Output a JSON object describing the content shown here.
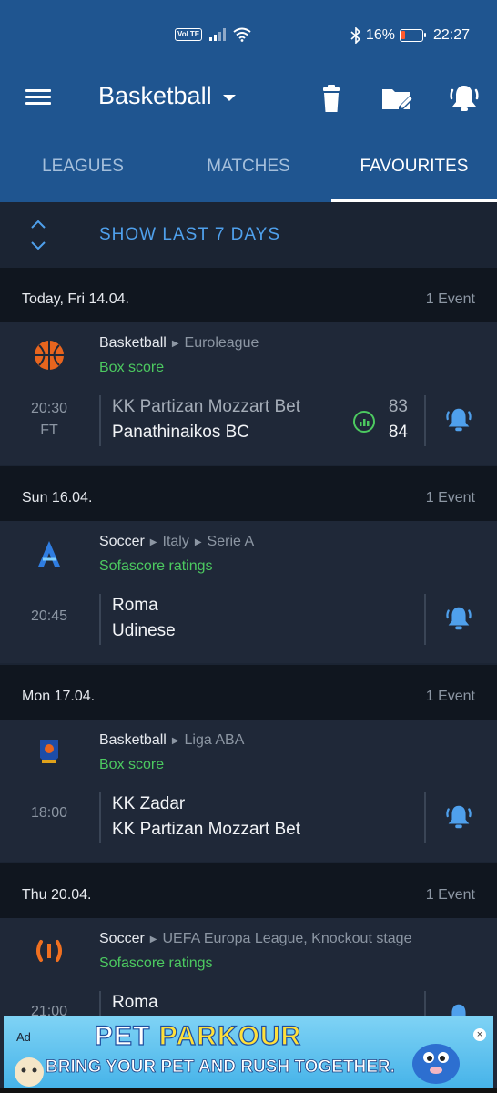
{
  "status_bar": {
    "volte": "VoLTE",
    "battery": "16%",
    "time": "22:27"
  },
  "toolbar": {
    "title": "Basketball",
    "icons": [
      "menu-icon",
      "delete-icon",
      "edit-folder-icon",
      "bell-icon"
    ]
  },
  "tabs": [
    {
      "label": "LEAGUES",
      "active": false
    },
    {
      "label": "MATCHES",
      "active": false
    },
    {
      "label": "FAVOURITES",
      "active": true
    }
  ],
  "show_last": "SHOW LAST 7 DAYS",
  "groups": [
    {
      "date": "Today, Fri 14.04.",
      "count": "1 Event",
      "event": {
        "sport": "Basketball",
        "path": [
          "Euroleague"
        ],
        "link": "Box score",
        "time": "20:30",
        "status": "FT",
        "home": "KK Partizan Mozzart Bet",
        "away": "Panathinaikos BC",
        "home_score": "83",
        "away_score": "84"
      }
    },
    {
      "date": "Sun 16.04.",
      "count": "1 Event",
      "event": {
        "sport": "Soccer",
        "path": [
          "Italy",
          "Serie A"
        ],
        "link": "Sofascore ratings",
        "time": "20:45",
        "home": "Roma",
        "away": "Udinese"
      }
    },
    {
      "date": "Mon 17.04.",
      "count": "1 Event",
      "event": {
        "sport": "Basketball",
        "path": [
          "Liga ABA"
        ],
        "link": "Box score",
        "time": "18:00",
        "home": "KK Zadar",
        "away": "KK Partizan Mozzart Bet"
      }
    },
    {
      "date": "Thu 20.04.",
      "count": "1 Event",
      "event": {
        "sport": "Soccer",
        "path": [
          "UEFA Europa League, Knockout stage"
        ],
        "link": "Sofascore ratings",
        "time": "21:00",
        "home": "Roma"
      }
    }
  ],
  "ad": {
    "label": "Ad",
    "title_a": "PET",
    "title_b": "PARKOUR",
    "subtitle": "BRING YOUR PET AND RUSH TOGETHER."
  },
  "colors": {
    "header": "#1f5590",
    "background": "#1b2433",
    "card": "#1f2838",
    "accent_blue": "#4fa0ec",
    "accent_green": "#4cc960"
  }
}
